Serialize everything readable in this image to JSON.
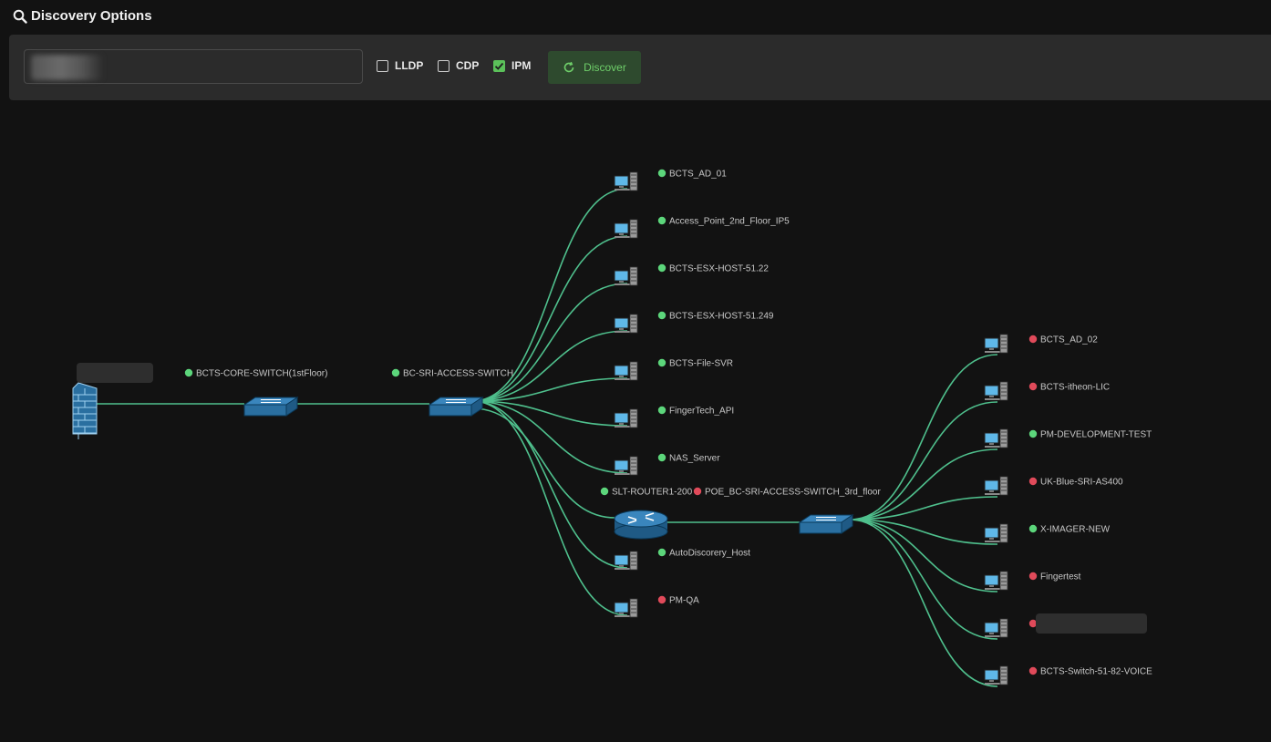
{
  "header": {
    "title": "Discovery Options"
  },
  "options": {
    "input": {
      "value": "",
      "placeholder": ""
    },
    "checkboxes": [
      {
        "label": "LLDP",
        "checked": false
      },
      {
        "label": "CDP",
        "checked": false
      },
      {
        "label": "IPM",
        "checked": true
      }
    ],
    "discover_label": "Discover"
  },
  "colors": {
    "link": "#4fc08d",
    "status_up": "#5cd67b",
    "status_down": "#e04a5a",
    "device": "#2a6fa0",
    "accent_button": "#6fcf6a"
  },
  "topology": {
    "firewall": {
      "label": "",
      "status": "up",
      "icon": "firewall-icon"
    },
    "core_switch": {
      "label": "BCTS-CORE-SWITCH(1stFloor)",
      "status": "up",
      "icon": "switch-icon"
    },
    "access_switch": {
      "label": "BC-SRI-ACCESS-SWITCH",
      "status": "up",
      "icon": "switch-icon"
    },
    "router": {
      "label": "SLT-ROUTER1-200",
      "status": "up",
      "icon": "router-icon"
    },
    "poe_switch": {
      "label": "POE_BC-SRI-ACCESS-SWITCH_3rd_floor",
      "status": "down",
      "icon": "switch-icon"
    },
    "access_hosts": [
      {
        "label": "BCTS_AD_01",
        "status": "up"
      },
      {
        "label": "Access_Point_2nd_Floor_IP5",
        "status": "up"
      },
      {
        "label": "BCTS-ESX-HOST-51.22",
        "status": "up"
      },
      {
        "label": "BCTS-ESX-HOST-51.249",
        "status": "up"
      },
      {
        "label": "BCTS-File-SVR",
        "status": "up"
      },
      {
        "label": "FingerTech_API",
        "status": "up"
      },
      {
        "label": "NAS_Server",
        "status": "up"
      },
      {
        "label": "AutoDiscorery_Host",
        "status": "up"
      },
      {
        "label": "PM-QA",
        "status": "down"
      }
    ],
    "poe_hosts": [
      {
        "label": "BCTS_AD_02",
        "status": "down"
      },
      {
        "label": "BCTS-itheon-LIC",
        "status": "down"
      },
      {
        "label": "PM-DEVELOPMENT-TEST",
        "status": "up"
      },
      {
        "label": "UK-Blue-SRI-AS400",
        "status": "down"
      },
      {
        "label": "X-IMAGER-NEW",
        "status": "up"
      },
      {
        "label": "Fingertest",
        "status": "down"
      },
      {
        "label": "",
        "status": "down"
      },
      {
        "label": "BCTS-Switch-51-82-VOICE",
        "status": "down"
      }
    ]
  }
}
